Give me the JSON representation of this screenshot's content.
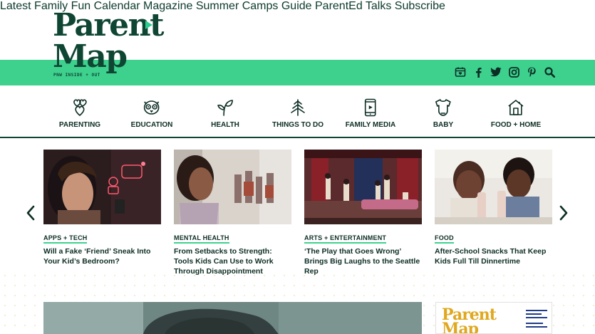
{
  "logo": {
    "line1": "Parent",
    "line2": "Map",
    "tagline": "PNW INSIDE + OUT"
  },
  "topnav": [
    "Latest",
    "Family Fun Calendar",
    "Magazine",
    "Summer Camps Guide",
    "ParentEd Talks",
    "Subscribe"
  ],
  "social": [
    "calendar-icon",
    "facebook-icon",
    "twitter-icon",
    "instagram-icon",
    "pinterest-icon",
    "search-icon"
  ],
  "categories": [
    {
      "label": "PARENTING",
      "icon": "hearts-icon"
    },
    {
      "label": "EDUCATION",
      "icon": "owl-icon"
    },
    {
      "label": "HEALTH",
      "icon": "sprout-icon"
    },
    {
      "label": "THINGS TO DO",
      "icon": "tree-icon"
    },
    {
      "label": "FAMILY MEDIA",
      "icon": "phone-icon"
    },
    {
      "label": "BABY",
      "icon": "onesie-icon"
    },
    {
      "label": "FOOD + HOME",
      "icon": "house-icon"
    }
  ],
  "cards": [
    {
      "kicker": "APPS + TECH",
      "title": "Will a Fake ‘Friend’ Sneak Into Your Kid’s Bedroom?"
    },
    {
      "kicker": "MENTAL HEALTH",
      "title": "From Setbacks to Strength: Tools Kids Can Use to Work Through Disappointment"
    },
    {
      "kicker": "ARTS + ENTERTAINMENT",
      "title": "‘The Play that Goes Wrong’ Brings Big Laughs to the Seattle Rep"
    },
    {
      "kicker": "FOOD",
      "title": "After-School Snacks That Keep Kids Full Till Dinnertime"
    }
  ],
  "carousel": {
    "prev": "‹",
    "next": "›"
  },
  "magazine": {
    "line1": "Parent",
    "line2": "Map"
  },
  "colors": {
    "brand_green": "#3ed18e",
    "dark_green": "#0f4633",
    "text": "#0d2e25"
  }
}
